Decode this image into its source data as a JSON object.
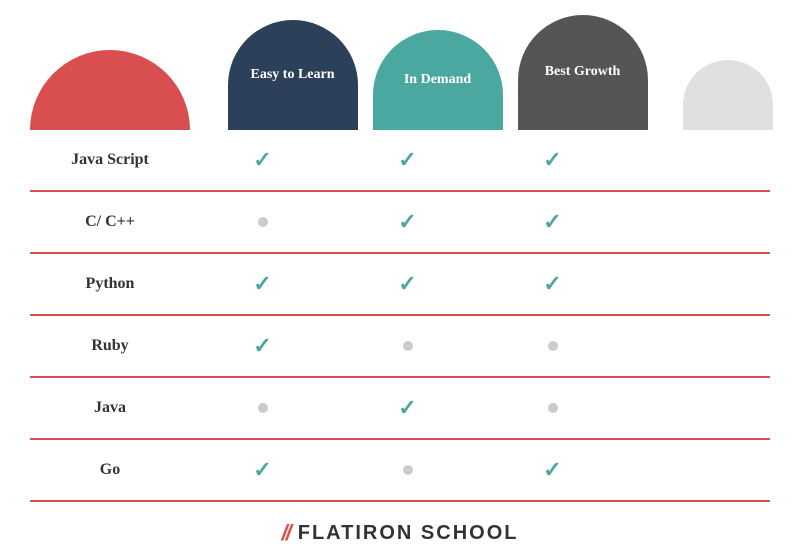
{
  "header": {
    "lang_col_label": "",
    "col1_label": "Easy to Learn",
    "col2_label": "In Demand",
    "col3_label": "Best Growth"
  },
  "rows": [
    {
      "lang": "Java Script",
      "easy": true,
      "demand": true,
      "growth": true
    },
    {
      "lang": "C/ C++",
      "easy": false,
      "demand": true,
      "growth": true
    },
    {
      "lang": "Python",
      "easy": true,
      "demand": true,
      "growth": true
    },
    {
      "lang": "Ruby",
      "easy": true,
      "demand": false,
      "growth": false
    },
    {
      "lang": "Java",
      "easy": false,
      "demand": true,
      "growth": false
    },
    {
      "lang": "Go",
      "easy": true,
      "demand": false,
      "growth": true
    }
  ],
  "footer": {
    "slashes": "//",
    "school_name": "FLATIRON SCHOOL"
  },
  "colors": {
    "accent_red": "#d94f4f",
    "teal": "#4ba8a0",
    "dark_blue": "#2d4059",
    "dark_gray": "#555555",
    "light_gray": "#e0e0e0",
    "dot_gray": "#cccccc"
  }
}
